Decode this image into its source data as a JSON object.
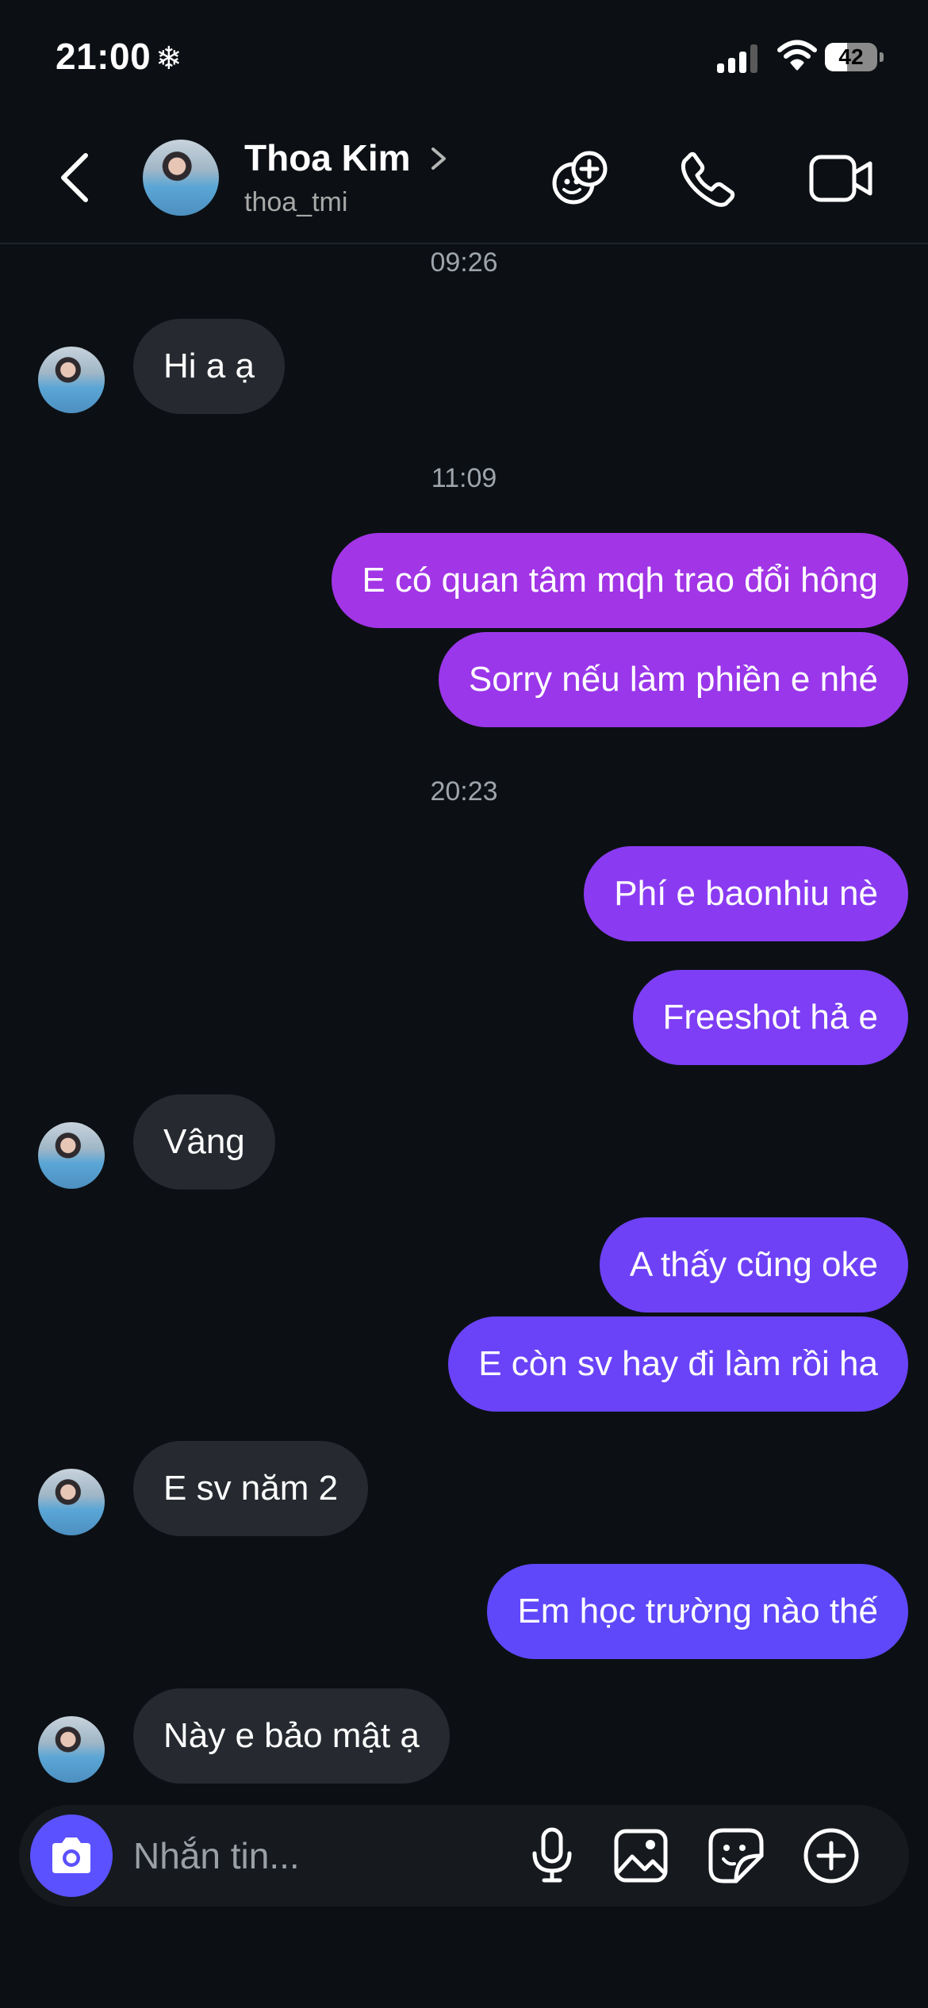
{
  "status_bar": {
    "time": "21:00",
    "time_symbol": "❄",
    "battery": "42",
    "battery_level": 0.42
  },
  "header": {
    "contact_name": "Thoa Kim",
    "username": "thoa_tmi"
  },
  "messages": [
    {
      "type": "timestamp",
      "text": "09:26"
    },
    {
      "type": "incoming",
      "text": "Hi a ạ"
    },
    {
      "type": "timestamp",
      "text": "11:09"
    },
    {
      "type": "outgoing",
      "text": "E có quan tâm mqh trao đổi hông",
      "color": "#a235e6"
    },
    {
      "type": "outgoing",
      "text": "Sorry nếu làm phiền e nhé",
      "color": "#9a37ea"
    },
    {
      "type": "timestamp",
      "text": "20:23"
    },
    {
      "type": "outgoing",
      "text": "Phí e baonhiu nè",
      "color": "#8a3bf2"
    },
    {
      "type": "outgoing",
      "text": "Freeshot hả e",
      "color": "#7d3ef5"
    },
    {
      "type": "incoming",
      "text": "Vâng"
    },
    {
      "type": "outgoing",
      "text": "A thấy cũng oke",
      "color": "#6e41f7"
    },
    {
      "type": "outgoing",
      "text": "E còn sv hay đi làm rồi ha",
      "color": "#6a43f8"
    },
    {
      "type": "incoming",
      "text": "E sv năm 2"
    },
    {
      "type": "outgoing",
      "text": "Em học trường nào thế",
      "color": "#5e48fa"
    },
    {
      "type": "incoming",
      "text": "Này e bảo mật ạ"
    }
  ],
  "composer": {
    "placeholder": "Nhắn tin..."
  },
  "icons": {
    "back": "chevron-left-icon",
    "games": "games-icon",
    "call": "phone-icon",
    "video": "video-camera-icon",
    "camera": "camera-icon",
    "mic": "microphone-icon",
    "gallery": "image-icon",
    "sticker": "sticker-icon",
    "add": "plus-circle-icon"
  }
}
